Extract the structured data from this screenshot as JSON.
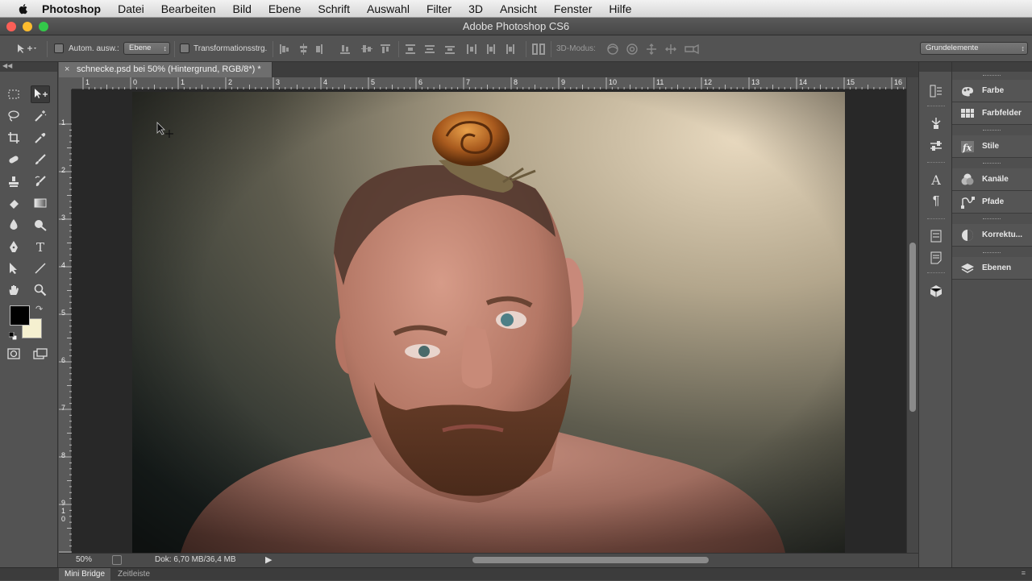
{
  "menubar": {
    "app": "Photoshop",
    "items": [
      "Datei",
      "Bearbeiten",
      "Bild",
      "Ebene",
      "Schrift",
      "Auswahl",
      "Filter",
      "3D",
      "Ansicht",
      "Fenster",
      "Hilfe"
    ]
  },
  "window": {
    "title": "Adobe Photoshop CS6"
  },
  "options": {
    "auto_select_label": "Autom. ausw.:",
    "auto_select_value": "Ebene",
    "transform_label": "Transformationsstrg.",
    "mode_label": "3D-Modus:",
    "workspace": "Grundelemente"
  },
  "document": {
    "tab_title": "schnecke.psd bei 50% (Hintergrund, RGB/8*) *",
    "close": "×"
  },
  "rulers": {
    "top": [
      "1",
      "0",
      "1",
      "2",
      "3",
      "4",
      "5",
      "6",
      "7",
      "8",
      "9",
      "10",
      "11",
      "12",
      "13",
      "14",
      "15",
      "16"
    ],
    "left": [
      "1",
      "2",
      "3",
      "4",
      "5",
      "6",
      "7",
      "8",
      "9",
      "1",
      "0"
    ]
  },
  "status": {
    "zoom": "50%",
    "doc": "Dok: 6,70 MB/36,4 MB"
  },
  "bottom": {
    "tabs": [
      "Mini Bridge",
      "Zeitleiste"
    ]
  },
  "panels": [
    {
      "label": "Farbe",
      "icon": "color-icon"
    },
    {
      "label": "Farbfelder",
      "icon": "swatches-icon"
    },
    {
      "label": "Stile",
      "icon": "styles-icon"
    },
    {
      "label": "Kanäle",
      "icon": "channels-icon"
    },
    {
      "label": "Pfade",
      "icon": "paths-icon"
    },
    {
      "label": "Korrektu...",
      "icon": "adjustments-icon"
    },
    {
      "label": "Ebenen",
      "icon": "layers-icon"
    }
  ],
  "colors": {
    "foreground": "#000000",
    "background": "#f5f0d0",
    "accent_close": "#fc5f57",
    "accent_min": "#fdbc2e",
    "accent_max": "#34c84a"
  }
}
